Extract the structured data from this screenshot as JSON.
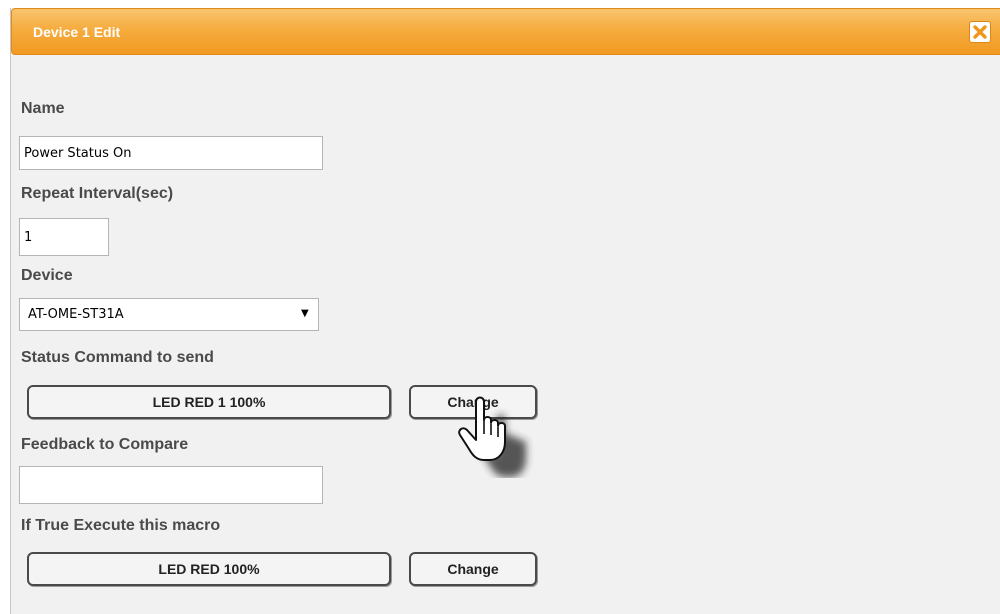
{
  "dialog": {
    "title": "Device 1 Edit",
    "close_icon": "close-icon"
  },
  "form": {
    "name_label": "Name",
    "name_value": "Power Status On",
    "repeat_label": "Repeat Interval(sec)",
    "repeat_value": "1",
    "device_label": "Device",
    "device_value": "AT-OME-ST31A",
    "status_label": "Status Command to send",
    "status_command": "LED RED 1 100%",
    "status_change": "Change",
    "feedback_label": "Feedback to Compare",
    "feedback_value": "",
    "macro_label": "If True Execute this macro",
    "macro_value": "LED RED 100%",
    "macro_change": "Change"
  },
  "colors": {
    "titlebar": "#f6ac3e",
    "background": "#f1f1f1",
    "close_x": "#f0961e"
  },
  "cursor_icon": "hand-pointer-icon"
}
